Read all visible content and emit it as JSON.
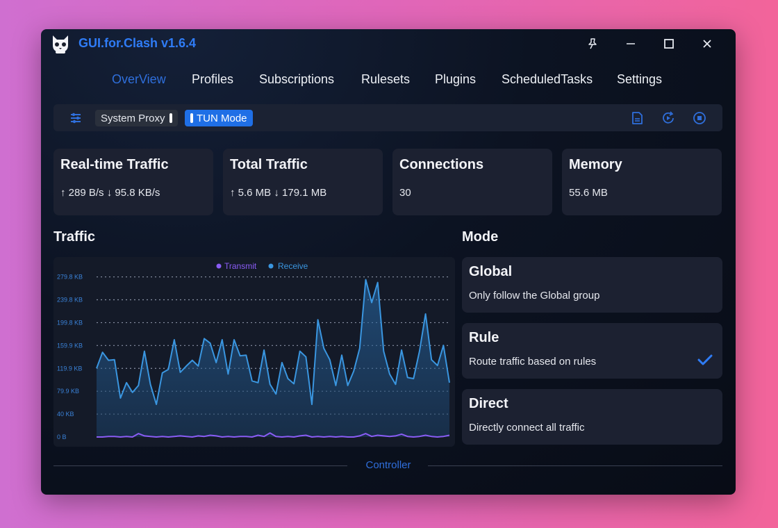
{
  "window": {
    "title": "GUI.for.Clash v1.6.4"
  },
  "nav": {
    "items": [
      {
        "label": "OverView",
        "active": true
      },
      {
        "label": "Profiles"
      },
      {
        "label": "Subscriptions"
      },
      {
        "label": "Rulesets"
      },
      {
        "label": "Plugins"
      },
      {
        "label": "ScheduledTasks"
      },
      {
        "label": "Settings"
      }
    ]
  },
  "toolbar": {
    "system_proxy_label": "System Proxy",
    "system_proxy_on": false,
    "tun_mode_label": "TUN Mode",
    "tun_mode_on": true,
    "icons": [
      "sliders-icon",
      "save-file-icon",
      "restart-icon",
      "stop-icon"
    ]
  },
  "cards": {
    "realtime": {
      "title": "Real-time Traffic",
      "value": "↑ 289 B/s ↓ 95.8 KB/s"
    },
    "total": {
      "title": "Total Traffic",
      "value": "↑ 5.6 MB ↓ 179.1 MB"
    },
    "connections": {
      "title": "Connections",
      "value": "30"
    },
    "memory": {
      "title": "Memory",
      "value": "55.6 MB"
    }
  },
  "traffic": {
    "title": "Traffic"
  },
  "mode": {
    "title": "Mode",
    "options": [
      {
        "title": "Global",
        "description": "Only follow the Global group",
        "selected": false
      },
      {
        "title": "Rule",
        "description": "Route traffic based on rules",
        "selected": true
      },
      {
        "title": "Direct",
        "description": "Directly connect all traffic",
        "selected": false
      }
    ]
  },
  "footer": {
    "label": "Controller"
  },
  "colors": {
    "accent": "#2f6fdc",
    "transmit": "#8a5cf5",
    "receive": "#3a96e0"
  },
  "chart_data": {
    "type": "area",
    "legend": [
      "Transmit",
      "Receive"
    ],
    "legend_position": "top-center",
    "y_tick_labels": [
      "0 B",
      "40 KB",
      "79.9 KB",
      "119.9 KB",
      "159.9 KB",
      "199.8 KB",
      "239.8 KB",
      "279.8 KB"
    ],
    "y_tick_values": [
      0,
      40,
      79.9,
      119.9,
      159.9,
      199.8,
      239.8,
      279.8
    ],
    "ylim": [
      0,
      289
    ],
    "y_unit": "KB",
    "grid": true,
    "series": [
      {
        "name": "Receive",
        "values": [
          120,
          148,
          134,
          135,
          68,
          95,
          78,
          90,
          150,
          92,
          57,
          112,
          118,
          170,
          113,
          124,
          134,
          124,
          172,
          164,
          130,
          170,
          110,
          170,
          142,
          143,
          98,
          95,
          152,
          92,
          75,
          130,
          102,
          93,
          150,
          140,
          57,
          205,
          155,
          135,
          90,
          143,
          90,
          115,
          155,
          275,
          235,
          270,
          150,
          110,
          92,
          152,
          104,
          102,
          150,
          215,
          135,
          125,
          160,
          95
        ]
      },
      {
        "name": "Transmit",
        "values": [
          0,
          0,
          1,
          1,
          0,
          1,
          0,
          6,
          2,
          1,
          0,
          1,
          0,
          1,
          2,
          1,
          0,
          2,
          1,
          3,
          2,
          0,
          1,
          0,
          1,
          1,
          0,
          3,
          1,
          7,
          1,
          0,
          1,
          0,
          2,
          3,
          0,
          1,
          0,
          1,
          0,
          1,
          0,
          0,
          2,
          6,
          1,
          3,
          2,
          1,
          2,
          5,
          1,
          0,
          1,
          3,
          1,
          0,
          1,
          3
        ]
      }
    ]
  }
}
